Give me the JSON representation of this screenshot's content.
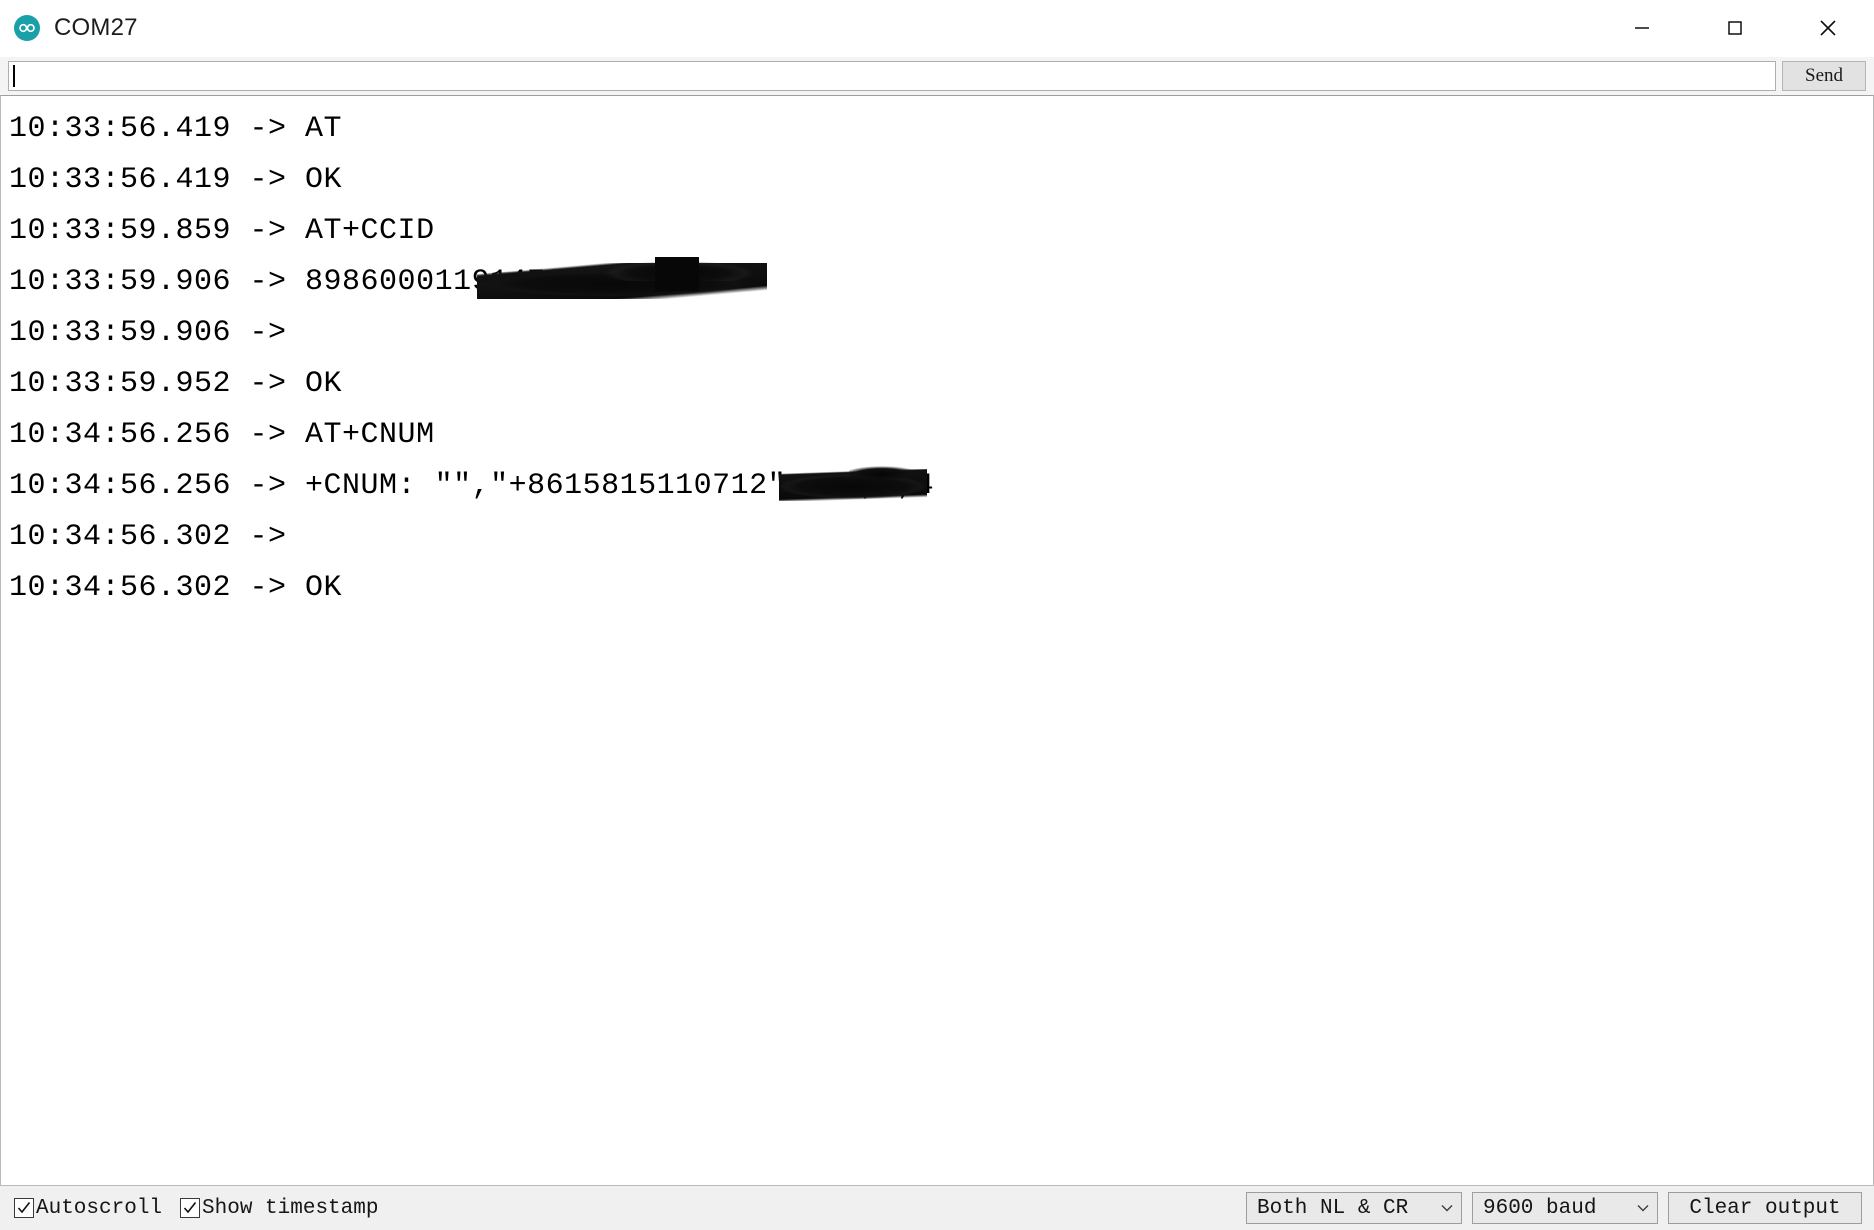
{
  "window": {
    "title": "COM27",
    "app_icon": "arduino-infinity-icon",
    "controls": {
      "minimize": "minimize-icon",
      "maximize": "maximize-icon",
      "close": "close-icon"
    }
  },
  "send_bar": {
    "input_value": "",
    "input_placeholder": "",
    "send_label": "Send"
  },
  "terminal": {
    "lines": [
      {
        "timestamp": "10:33:56.419",
        "arrow": "->",
        "text": "AT",
        "redaction": "none"
      },
      {
        "timestamp": "10:33:56.419",
        "arrow": "->",
        "text": "OK",
        "redaction": "none"
      },
      {
        "timestamp": "10:33:59.859",
        "arrow": "->",
        "text": "AT+CCID",
        "redaction": "none"
      },
      {
        "timestamp": "10:33:59.906",
        "arrow": "->",
        "text": "89860001191472787 8882",
        "redaction": "ccid"
      },
      {
        "timestamp": "10:33:59.906",
        "arrow": "->",
        "text": "",
        "redaction": "none"
      },
      {
        "timestamp": "10:33:59.952",
        "arrow": "->",
        "text": "OK",
        "redaction": "none"
      },
      {
        "timestamp": "10:34:56.256",
        "arrow": "->",
        "text": "AT+CNUM",
        "redaction": "none"
      },
      {
        "timestamp": "10:34:56.256",
        "arrow": "->",
        "text": "+CNUM: \"\",\"+8615815110712\",145,0,4",
        "redaction": "cnum"
      },
      {
        "timestamp": "10:34:56.302",
        "arrow": "->",
        "text": "",
        "redaction": "none"
      },
      {
        "timestamp": "10:34:56.302",
        "arrow": "->",
        "text": "OK",
        "redaction": "none"
      }
    ]
  },
  "status_bar": {
    "autoscroll_label": "Autoscroll",
    "autoscroll_checked": true,
    "show_timestamp_label": "Show timestamp",
    "show_timestamp_checked": true,
    "line_ending_value": "Both NL & CR",
    "baud_value": "9600 baud",
    "clear_output_label": "Clear output"
  },
  "colors": {
    "accent": "#1aa0a8",
    "titlebar_bg": "#ffffff",
    "toolbar_bg": "#f4f4f4",
    "statusbar_bg": "#f0f0f0",
    "terminal_bg": "#ffffff",
    "text": "#000000"
  }
}
